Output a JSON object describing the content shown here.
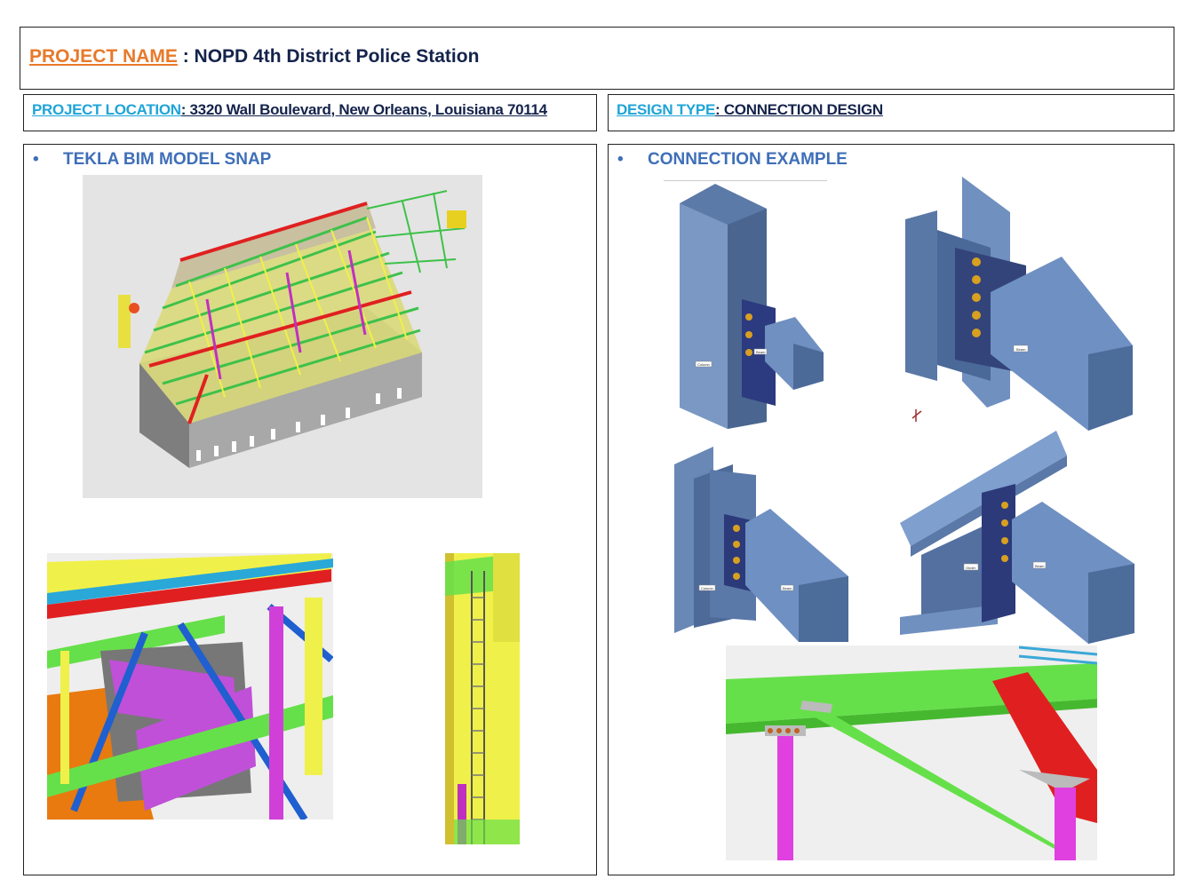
{
  "header": {
    "project_name_label": "PROJECT NAME",
    "project_name_sep": " : ",
    "project_name_value": "NOPD 4th District Police Station"
  },
  "location": {
    "label": "PROJECT LOCATION",
    "sep": ": ",
    "value": "3320 Wall Boulevard, New Orleans, Louisiana 70114"
  },
  "design": {
    "label": "DESIGN TYPE",
    "sep": ": ",
    "value": "CONNECTION DESIGN"
  },
  "left_panel": {
    "bullet": "•",
    "heading": "TEKLA BIM MODEL SNAP"
  },
  "right_panel": {
    "bullet": "•",
    "heading": "CONNECTION EXAMPLE"
  },
  "connection_labels": {
    "column": "Column",
    "beam": "Beam",
    "girder": "Girder"
  },
  "colors": {
    "accent_orange": "#e8792a",
    "accent_cyan": "#1fa4d8",
    "navy": "#14234b",
    "heading_blue": "#3f6fb8",
    "steel_blue": "#6f8fbf",
    "member_green": "#66e04a",
    "member_yellow": "#f0f04a",
    "member_magenta": "#e040e0",
    "member_red": "#e02020"
  }
}
